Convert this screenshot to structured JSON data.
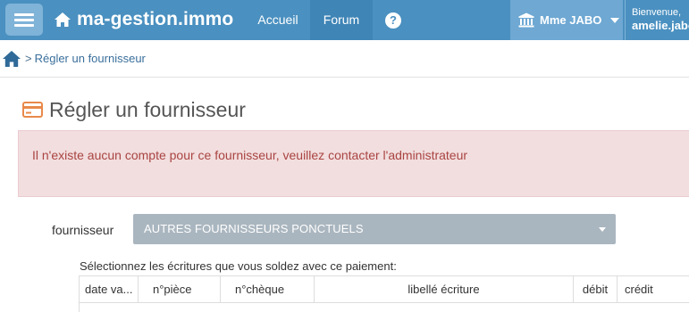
{
  "navbar": {
    "brand": "ma-gestion.immo",
    "links": [
      {
        "label": "Accueil"
      },
      {
        "label": "Forum"
      }
    ],
    "help_label": "?",
    "user_label": "Mme JABO",
    "welcome_line1": "Bienvenue,",
    "welcome_line2": "amelie.jabo",
    "colors": {
      "bar": "#4a90c0",
      "active": "#3f85b6",
      "user": "#6ea8d3"
    }
  },
  "breadcrumb": {
    "separator": ">",
    "current": "Régler un fournisseur"
  },
  "page": {
    "title": "Régler un fournisseur",
    "alert": "Il n'existe aucun compte pour ce fournisseur, veuillez contacter l'administrateur"
  },
  "form": {
    "fournisseur_label": "fournisseur",
    "fournisseur_value": "AUTRES FOURNISSEURS PONCTUELS"
  },
  "table": {
    "caption": "Sélectionnez les écritures que vous soldez avec ce paiement:",
    "columns": [
      "date va...",
      "n°pièce",
      "n°chèque",
      "libellé écriture",
      "débit",
      "crédit"
    ]
  }
}
